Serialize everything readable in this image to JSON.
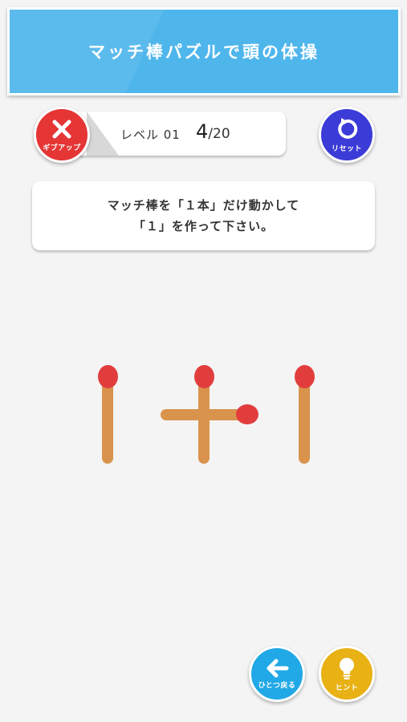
{
  "header": {
    "title": "マッチ棒パズルで頭の体操"
  },
  "level": {
    "label": "レベル 01",
    "current": "4",
    "total": "/20"
  },
  "buttons": {
    "giveup_label": "ギブアップ",
    "reset_label": "リセット",
    "back_label": "ひとつ戻る",
    "hint_label": "ヒント"
  },
  "instruction": {
    "line1": "マッチ棒を「１本」だけ動かして",
    "line2": "「１」を作って下さい。"
  },
  "puzzle": {
    "matches": [
      {
        "name": "match-vertical-left",
        "orientation": "vertical"
      },
      {
        "name": "match-plus-vertical",
        "orientation": "vertical"
      },
      {
        "name": "match-plus-horizontal",
        "orientation": "horizontal"
      },
      {
        "name": "match-vertical-right",
        "orientation": "vertical"
      }
    ]
  },
  "colors": {
    "header": "#4fb6ec",
    "giveup": "#e53535",
    "reset": "#3b3bd8",
    "back": "#21a8e6",
    "hint": "#e8b114",
    "match_stick": "#d9934d",
    "match_head": "#e23d3d"
  },
  "icons": {
    "giveup": "close-icon",
    "reset": "reset-arrow-icon",
    "back": "back-arrow-icon",
    "hint": "lightbulb-icon"
  }
}
